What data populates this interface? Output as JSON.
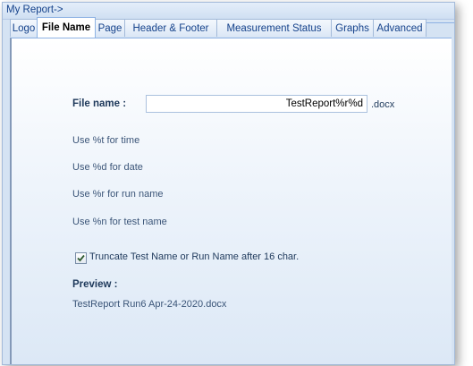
{
  "window": {
    "title": "My Report->"
  },
  "tabs": [
    "Logo",
    "File Name",
    "Page",
    "Header & Footer",
    "Measurement Status",
    "Graphs",
    "Advanced"
  ],
  "file_name": {
    "label": "File name :",
    "value": "TestReport%r%d",
    "extension": ".docx"
  },
  "hints": [
    "Use %t for time",
    "Use %d for date",
    "Use %r for run name",
    "Use %n for test name"
  ],
  "truncate": {
    "label": "Truncate Test Name or Run Name after 16 char.",
    "checked": true
  },
  "preview": {
    "label": "Preview :",
    "value": "TestReport Run6 Apr-24-2020.docx"
  },
  "colors": {
    "panel_bg": "#d5e3f3",
    "tab_border": "#a3bad9",
    "title_text": "#15428b"
  }
}
